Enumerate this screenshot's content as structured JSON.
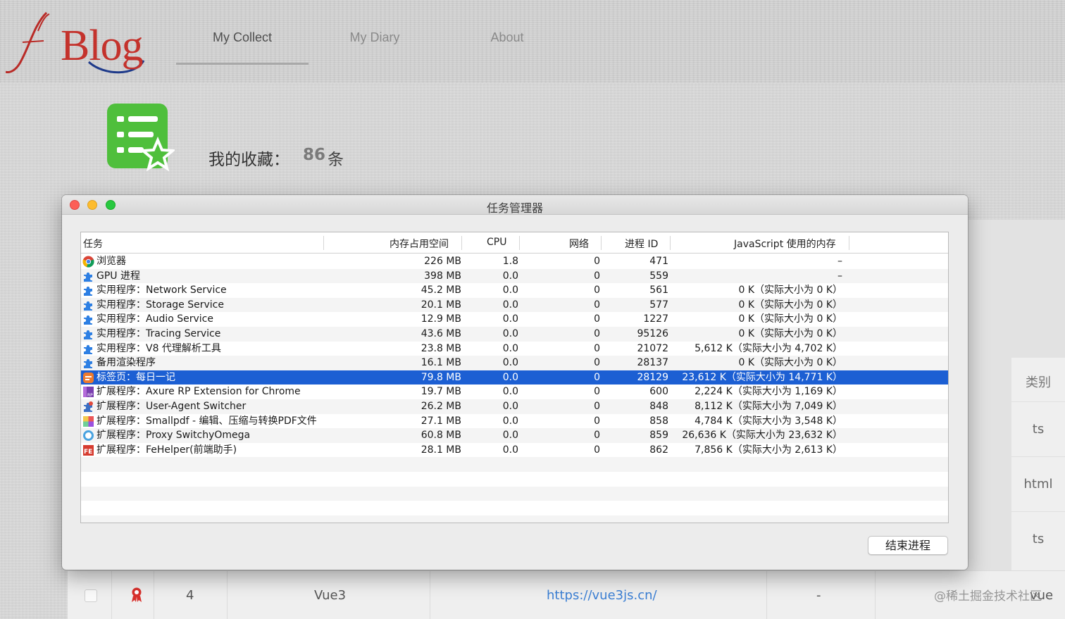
{
  "blog": {
    "logo_text": "Blog",
    "nav": [
      "My Collect",
      "My Diary",
      "About"
    ]
  },
  "collection": {
    "title": "我的收藏：",
    "count": "86",
    "unit": "条"
  },
  "background_table": {
    "category_header": "类别",
    "categories": [
      "ts",
      "html",
      "ts"
    ],
    "last_row": {
      "index": "4",
      "name": "Vue3",
      "url": "https://vue3js.cn/",
      "dash": "-",
      "category": "vue"
    }
  },
  "watermark": "@稀土掘金技术社区",
  "task_manager": {
    "title": "任务管理器",
    "headers": {
      "task": "任务",
      "memory": "内存占用空间",
      "cpu": "CPU",
      "network": "网络",
      "pid": "进程 ID",
      "js_memory": "JavaScript 使用的内存"
    },
    "rows": [
      {
        "name": "浏览器",
        "mem": "226 MB",
        "cpu": "1.8",
        "net": "0",
        "pid": "471",
        "js": "–",
        "icon": "chrome-icon"
      },
      {
        "name": "GPU 进程",
        "mem": "398 MB",
        "cpu": "0.0",
        "net": "0",
        "pid": "559",
        "js": "–",
        "icon": "puzzle-icon"
      },
      {
        "name": "实用程序：Network Service",
        "mem": "45.2 MB",
        "cpu": "0.0",
        "net": "0",
        "pid": "561",
        "js": "0 K（实际大小为 0 K）",
        "icon": "puzzle-icon"
      },
      {
        "name": "实用程序：Storage Service",
        "mem": "20.1 MB",
        "cpu": "0.0",
        "net": "0",
        "pid": "577",
        "js": "0 K（实际大小为 0 K）",
        "icon": "puzzle-icon"
      },
      {
        "name": "实用程序：Audio Service",
        "mem": "12.9 MB",
        "cpu": "0.0",
        "net": "0",
        "pid": "1227",
        "js": "0 K（实际大小为 0 K）",
        "icon": "puzzle-icon"
      },
      {
        "name": "实用程序：Tracing Service",
        "mem": "43.6 MB",
        "cpu": "0.0",
        "net": "0",
        "pid": "95126",
        "js": "0 K（实际大小为 0 K）",
        "icon": "puzzle-icon"
      },
      {
        "name": "实用程序：V8 代理解析工具",
        "mem": "23.8 MB",
        "cpu": "0.0",
        "net": "0",
        "pid": "21072",
        "js": "5,612 K（实际大小为 4,702 K）",
        "icon": "puzzle-icon"
      },
      {
        "name": "备用渲染程序",
        "mem": "16.1 MB",
        "cpu": "0.0",
        "net": "0",
        "pid": "28137",
        "js": "0 K（实际大小为 0 K）",
        "icon": "puzzle-icon"
      },
      {
        "name": "标签页：每日一记",
        "mem": "79.8 MB",
        "cpu": "0.0",
        "net": "0",
        "pid": "28129",
        "js": "23,612 K（实际大小为 14,771 K）",
        "icon": "tab-icon",
        "selected": true
      },
      {
        "name": "扩展程序：Axure RP Extension for Chrome",
        "mem": "19.7 MB",
        "cpu": "0.0",
        "net": "0",
        "pid": "600",
        "js": "2,224 K（实际大小为 1,169 K）",
        "icon": "axure-icon"
      },
      {
        "name": "扩展程序：User-Agent Switcher",
        "mem": "26.2 MB",
        "cpu": "0.0",
        "net": "0",
        "pid": "848",
        "js": "8,112 K（实际大小为 7,049 K）",
        "icon": "useragent-icon"
      },
      {
        "name": "扩展程序：Smallpdf - 编辑、压缩与转换PDF文件",
        "mem": "27.1 MB",
        "cpu": "0.0",
        "net": "0",
        "pid": "858",
        "js": "4,784 K（实际大小为 3,548 K）",
        "icon": "smallpdf-icon"
      },
      {
        "name": "扩展程序：Proxy SwitchyOmega",
        "mem": "60.8 MB",
        "cpu": "0.0",
        "net": "0",
        "pid": "859",
        "js": "26,636 K（实际大小为 23,632 K）",
        "icon": "switchyomega-icon"
      },
      {
        "name": "扩展程序：FeHelper(前端助手)",
        "mem": "28.1 MB",
        "cpu": "0.0",
        "net": "0",
        "pid": "862",
        "js": "7,856 K（实际大小为 2,613 K）",
        "icon": "fehelper-icon"
      }
    ],
    "end_button": "结束进程"
  }
}
